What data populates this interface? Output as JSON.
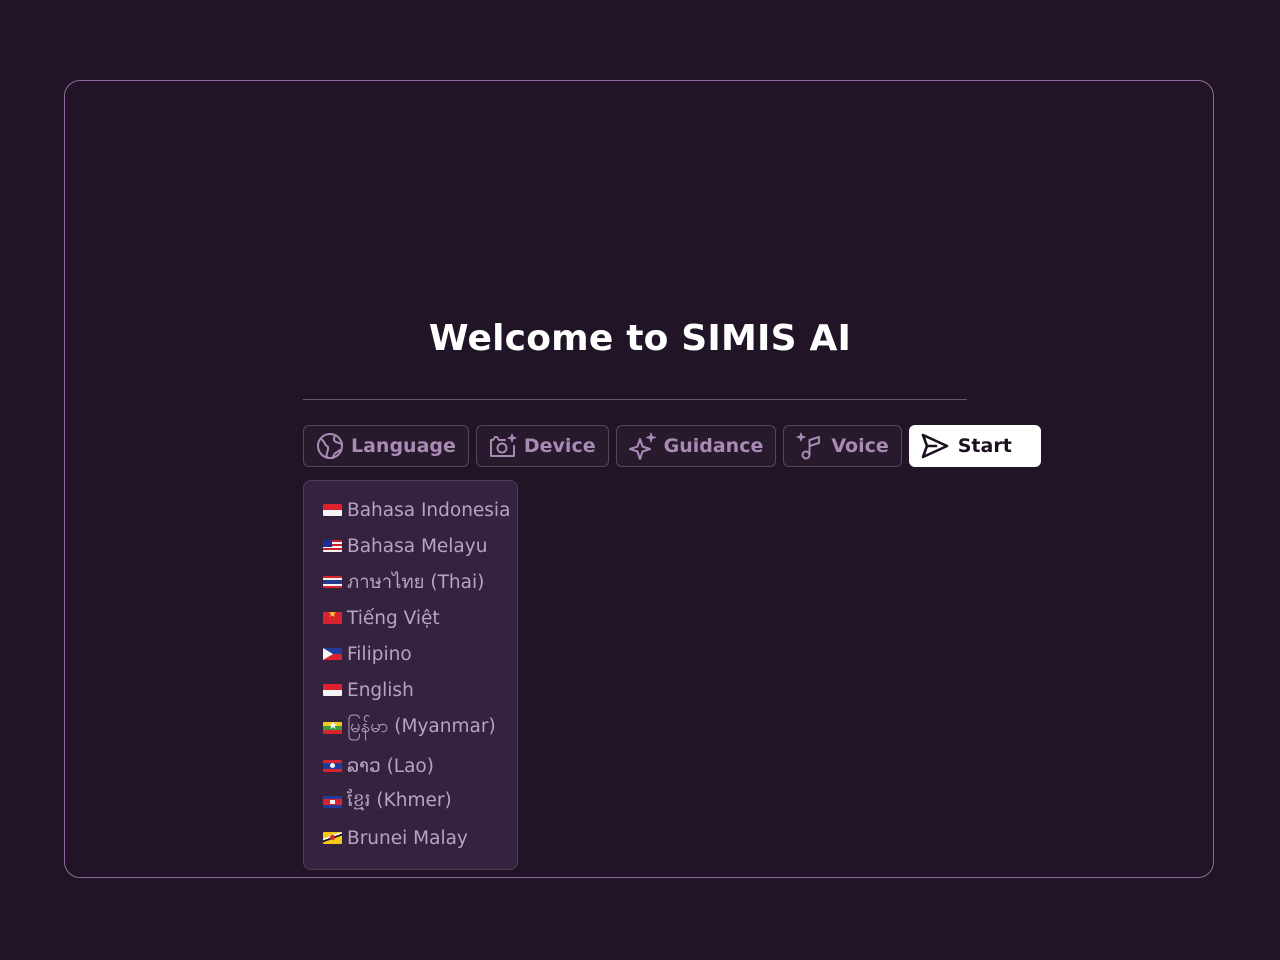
{
  "title": "Welcome to SIMIS AI",
  "toolbar": {
    "language_label": "Language",
    "device_label": "Device",
    "guidance_label": "Guidance",
    "voice_label": "Voice",
    "start_label": "Start"
  },
  "icons": {
    "language": "globe-icon",
    "device": "camera-sparkle-icon",
    "guidance": "sparkle-icon",
    "voice": "music-note-sparkle-icon",
    "start": "send-icon"
  },
  "language_menu": {
    "items": [
      {
        "label": "Bahasa Indonesia",
        "flag": "flag-indonesia"
      },
      {
        "label": "Bahasa Melayu",
        "flag": "flag-malaysia"
      },
      {
        "label": "ภาษาไทย (Thai)",
        "flag": "flag-thailand"
      },
      {
        "label": "Tiếng Việt",
        "flag": "flag-vietnam"
      },
      {
        "label": "Filipino",
        "flag": "flag-philippines"
      },
      {
        "label": "English",
        "flag": "flag-singapore"
      },
      {
        "label": "မြန်မာ (Myanmar)",
        "flag": "flag-myanmar"
      },
      {
        "label": "ລາວ (Lao)",
        "flag": "flag-laos"
      },
      {
        "label": "ខ្មែរ (Khmer)",
        "flag": "flag-cambodia"
      },
      {
        "label": "Brunei Malay",
        "flag": "flag-brunei"
      }
    ]
  },
  "colors": {
    "background": "#201426",
    "frame_border": "#8e6a9a",
    "button_text": "#a98ab4",
    "menu_background": "#35223f",
    "start_background": "#ffffff"
  }
}
